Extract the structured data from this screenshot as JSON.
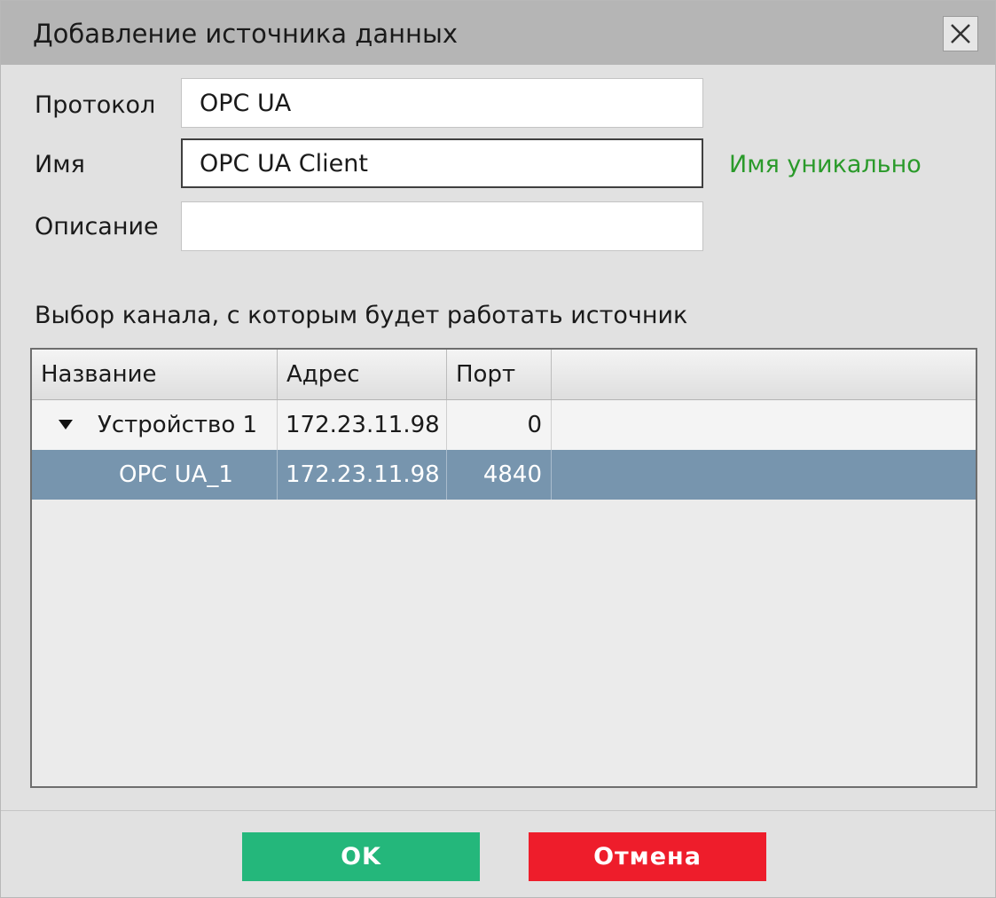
{
  "dialog": {
    "title": "Добавление источника данных"
  },
  "form": {
    "protocol_label": "Протокол",
    "protocol_value": "OPC UA",
    "name_label": "Имя",
    "name_value": "OPC UA Client",
    "name_status": "Имя уникально",
    "description_label": "Описание",
    "description_value": ""
  },
  "channel": {
    "caption": "Выбор канала, с которым будет работать источник",
    "columns": [
      "Название",
      "Адрес",
      "Порт"
    ],
    "rows": [
      {
        "name": "Устройство 1",
        "address": "172.23.11.98",
        "port": "0",
        "expanded": true,
        "selected": false
      },
      {
        "name": "OPC UA_1",
        "address": "172.23.11.98",
        "port": "4840",
        "expanded": false,
        "selected": true
      }
    ]
  },
  "buttons": {
    "ok": "OK",
    "cancel": "Отмена"
  },
  "colors": {
    "status_ok": "#2a9a2a",
    "selected_row": "#7795ae",
    "ok_button": "#24b77b",
    "cancel_button": "#ee1d2b"
  },
  "icons": {
    "close": "close-icon",
    "expand": "triangle-down-icon"
  }
}
